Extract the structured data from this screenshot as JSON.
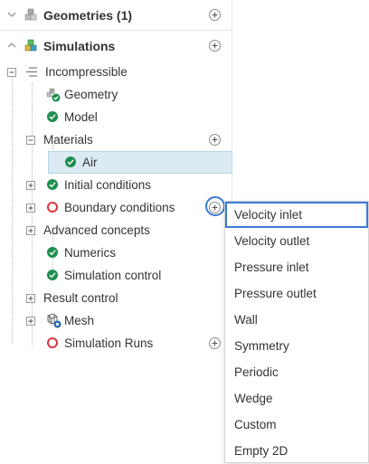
{
  "sections": {
    "geometries": {
      "title": "Geometries (1)",
      "icon": "cube-stack-icon"
    },
    "simulations": {
      "title": "Simulations",
      "icon": "simulation-cubes-icon"
    }
  },
  "tree": {
    "root_label": "Incompressible",
    "geometry": "Geometry",
    "model": "Model",
    "materials": "Materials",
    "air": "Air",
    "initial_conditions": "Initial conditions",
    "boundary_conditions": "Boundary conditions",
    "advanced_concepts": "Advanced concepts",
    "numerics": "Numerics",
    "simulation_control": "Simulation control",
    "result_control": "Result control",
    "mesh": "Mesh",
    "simulation_runs": "Simulation Runs"
  },
  "boundary_menu": {
    "items": [
      "Velocity inlet",
      "Velocity outlet",
      "Pressure inlet",
      "Pressure outlet",
      "Wall",
      "Symmetry",
      "Periodic",
      "Wedge",
      "Custom",
      "Empty 2D"
    ],
    "highlighted": "Velocity inlet"
  },
  "colors": {
    "ok_green": "#1e8f4e",
    "error_red": "#d9363e",
    "highlight_blue": "#3a7bd5",
    "selection_bg": "#dcebf3"
  }
}
